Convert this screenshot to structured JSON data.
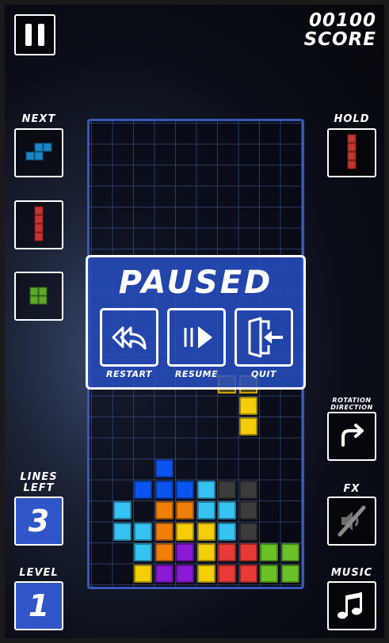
{
  "header": {
    "score_value": "00100",
    "score_label": "SCORE"
  },
  "left": {
    "next_label": "NEXT",
    "lines_left_label_1": "LINES",
    "lines_left_label_2": "LEFT",
    "lines_left_value": "3",
    "level_label": "LEVEL",
    "level_value": "1"
  },
  "right": {
    "hold_label": "HOLD",
    "rotation_label_1": "ROTATION",
    "rotation_label_2": "DIRECTION",
    "fx_label": "FX",
    "music_label": "MUSIC"
  },
  "pause_menu": {
    "title": "PAUSED",
    "restart_label": "RESTART",
    "resume_label": "RESUME",
    "quit_label": "QUIT"
  },
  "colors": {
    "blue": "#0a55f0",
    "cyan": "#36c3f2",
    "orange": "#f07f07",
    "yellow": "#f5cd09",
    "purple": "#8a1ad6",
    "red": "#e83a36",
    "green": "#6ac227",
    "gray": "#3c3c3c",
    "board_border": "#3a57b8",
    "panel": "#2f55c8"
  },
  "board_cells": [
    {
      "row": 16,
      "col": 3,
      "color": "blue"
    },
    {
      "row": 17,
      "col": 2,
      "color": "blue"
    },
    {
      "row": 17,
      "col": 3,
      "color": "blue"
    },
    {
      "row": 17,
      "col": 4,
      "color": "blue"
    },
    {
      "row": 17,
      "col": 5,
      "color": "cyan"
    },
    {
      "row": 17,
      "col": 6,
      "color": "gray"
    },
    {
      "row": 17,
      "col": 7,
      "color": "gray"
    },
    {
      "row": 18,
      "col": 1,
      "color": "cyan"
    },
    {
      "row": 18,
      "col": 3,
      "color": "orange"
    },
    {
      "row": 18,
      "col": 4,
      "color": "orange"
    },
    {
      "row": 18,
      "col": 5,
      "color": "cyan"
    },
    {
      "row": 18,
      "col": 6,
      "color": "cyan"
    },
    {
      "row": 18,
      "col": 7,
      "color": "gray"
    },
    {
      "row": 19,
      "col": 1,
      "color": "cyan"
    },
    {
      "row": 19,
      "col": 2,
      "color": "cyan"
    },
    {
      "row": 19,
      "col": 3,
      "color": "orange"
    },
    {
      "row": 19,
      "col": 4,
      "color": "yellow"
    },
    {
      "row": 19,
      "col": 5,
      "color": "yellow"
    },
    {
      "row": 19,
      "col": 6,
      "color": "cyan"
    },
    {
      "row": 19,
      "col": 7,
      "color": "gray"
    },
    {
      "row": 20,
      "col": 2,
      "color": "cyan"
    },
    {
      "row": 20,
      "col": 3,
      "color": "orange"
    },
    {
      "row": 20,
      "col": 4,
      "color": "purple"
    },
    {
      "row": 20,
      "col": 5,
      "color": "yellow"
    },
    {
      "row": 20,
      "col": 6,
      "color": "red"
    },
    {
      "row": 20,
      "col": 7,
      "color": "red"
    },
    {
      "row": 20,
      "col": 8,
      "color": "green"
    },
    {
      "row": 20,
      "col": 9,
      "color": "green"
    },
    {
      "row": 21,
      "col": 2,
      "color": "yellow"
    },
    {
      "row": 21,
      "col": 3,
      "color": "purple"
    },
    {
      "row": 21,
      "col": 4,
      "color": "purple"
    },
    {
      "row": 21,
      "col": 5,
      "color": "yellow"
    },
    {
      "row": 21,
      "col": 6,
      "color": "red"
    },
    {
      "row": 21,
      "col": 7,
      "color": "red"
    },
    {
      "row": 21,
      "col": 8,
      "color": "green"
    },
    {
      "row": 21,
      "col": 9,
      "color": "green"
    },
    {
      "row": 13,
      "col": 7,
      "color": "yellow"
    },
    {
      "row": 14,
      "col": 7,
      "color": "yellow"
    }
  ],
  "icons": {
    "pause": "pause-icon",
    "restart": "restart-icon",
    "resume": "resume-icon",
    "quit": "quit-icon",
    "rotation": "rotate-right-icon",
    "fx": "fx-muted-icon",
    "music": "music-notes-icon"
  }
}
